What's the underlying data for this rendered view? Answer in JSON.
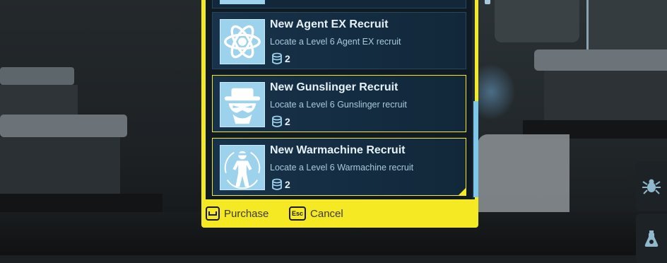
{
  "store": {
    "items": [
      {
        "title": "New Agent EX Recruit",
        "description": "Locate a Level 6 Agent EX recruit",
        "cost": "2",
        "icon": "atom-icon",
        "highlighted": false
      },
      {
        "title": "New Gunslinger Recruit",
        "description": "Locate a Level 6 Gunslinger recruit",
        "cost": "2",
        "icon": "gunslinger-hat-icon",
        "highlighted": true
      },
      {
        "title": "New Warmachine Recruit",
        "description": "Locate a Level 6 Warmachine recruit",
        "cost": "2",
        "icon": "warmachine-figure-icon",
        "highlighted": true
      }
    ],
    "footer": {
      "purchase_key": "",
      "purchase_label": "Purchase",
      "cancel_key": "Esc",
      "cancel_label": "Cancel"
    }
  },
  "side_icons": [
    "bug-icon",
    "flask-icon"
  ],
  "colors": {
    "accent_yellow": "#f4e922",
    "card_bg": "#17324a",
    "icon_bg": "#9dd2ec",
    "scroll_thumb": "#7ec7ea"
  }
}
